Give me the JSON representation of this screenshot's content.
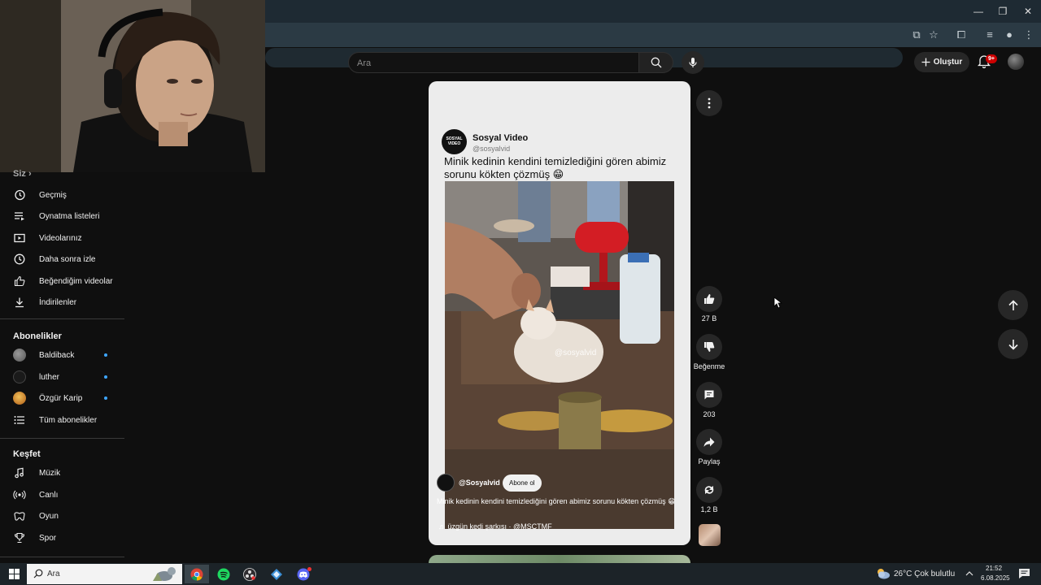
{
  "search": {
    "placeholder": "Ara"
  },
  "header": {
    "create_label": "Oluştur",
    "notif_badge": "9+"
  },
  "sidebar": {
    "you_label": "Siz",
    "you_items": [
      {
        "label": "Geçmiş",
        "icon": "history-icon"
      },
      {
        "label": "Oynatma listeleri",
        "icon": "playlists-icon"
      },
      {
        "label": "Videolarınız",
        "icon": "your-videos-icon"
      },
      {
        "label": "Daha sonra izle",
        "icon": "watch-later-icon"
      },
      {
        "label": "Beğendiğim videolar",
        "icon": "liked-icon"
      },
      {
        "label": "İndirilenler",
        "icon": "downloads-icon"
      }
    ],
    "subs_label": "Abonelikler",
    "subs": [
      {
        "label": "Baldiback"
      },
      {
        "label": "luther"
      },
      {
        "label": "Özgür Karip"
      },
      {
        "label": "Tüm abonelikler"
      }
    ],
    "explore_label": "Keşfet",
    "explore_items": [
      {
        "label": "Müzik",
        "icon": "music-icon"
      },
      {
        "label": "Canlı",
        "icon": "live-icon"
      },
      {
        "label": "Oyun",
        "icon": "gaming-icon"
      },
      {
        "label": "Spor",
        "icon": "sports-icon"
      }
    ]
  },
  "short": {
    "post_logo": "SOSYAL VIDEO",
    "post_name": "Sosyal Video",
    "post_handle": "@sosyalvid",
    "post_text": "Minik kedinin kendini temizlediğini gören abimiz sorunu kökten çözmüş 😁",
    "watermark": "@sosyalvid",
    "channel": "@Sosyalvid",
    "subscribe_label": "Abone ol",
    "title": "Minik kedinin kendini temizlediğini gören abimiz sorunu kökten çözmüş 😁",
    "music": "üzgün kedi şarkısı · @MSCTMF"
  },
  "actions": {
    "likes": "27 B",
    "dislike_label": "Beğenme",
    "comments": "203",
    "share_label": "Paylaş",
    "remix_count": "1,2 B"
  },
  "taskbar": {
    "search_placeholder": "Ara",
    "weather": "26°C  Çok bulutlu",
    "time": "21:52",
    "date": "6.08.2025"
  },
  "colors": {
    "accent_red": "#cc0000",
    "link_blue": "#3ea6ff"
  }
}
